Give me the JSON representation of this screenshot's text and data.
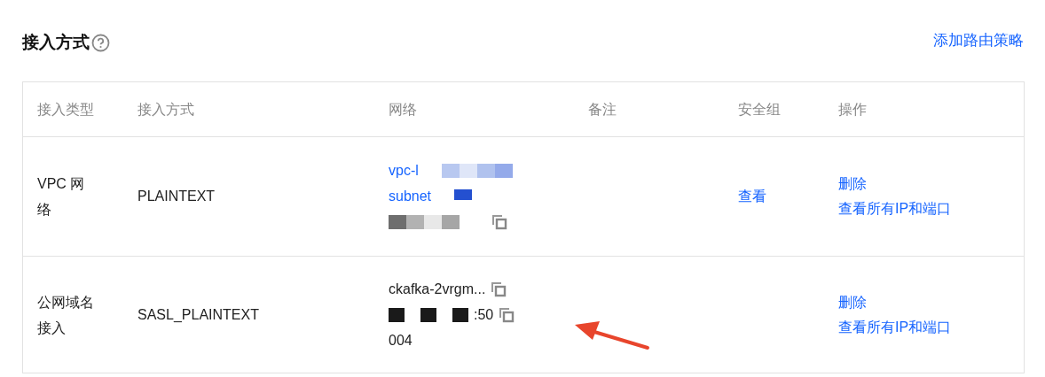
{
  "section": {
    "title": "接入方式",
    "action": "添加路由策略"
  },
  "table": {
    "columns": [
      "接入类型",
      "接入方式",
      "网络",
      "备注",
      "安全组",
      "操作"
    ],
    "rows": [
      {
        "type": "VPC 网络",
        "method": "PLAINTEXT",
        "network": [
          {
            "kind": "link",
            "text": "vpc-l",
            "redacted": true,
            "copy": false
          },
          {
            "kind": "link",
            "text": "subnet",
            "redacted": true,
            "copy": false
          },
          {
            "kind": "text",
            "redacted": true,
            "copy": true
          }
        ],
        "security": "查看",
        "actions": [
          "删除",
          "查看所有IP和端口"
        ]
      },
      {
        "type": "公网域名接入",
        "method": "SASL_PLAINTEXT",
        "network": [
          {
            "kind": "text",
            "text": "ckafka-2vrgm...",
            "copy": true
          },
          {
            "kind": "text",
            "text": ":50",
            "redacted": true,
            "copy": true
          },
          {
            "kind": "text",
            "text": "004",
            "copy": false
          }
        ],
        "actions": [
          "删除",
          "查看所有IP和端口"
        ]
      }
    ]
  },
  "annotation": {
    "kind": "arrow"
  }
}
